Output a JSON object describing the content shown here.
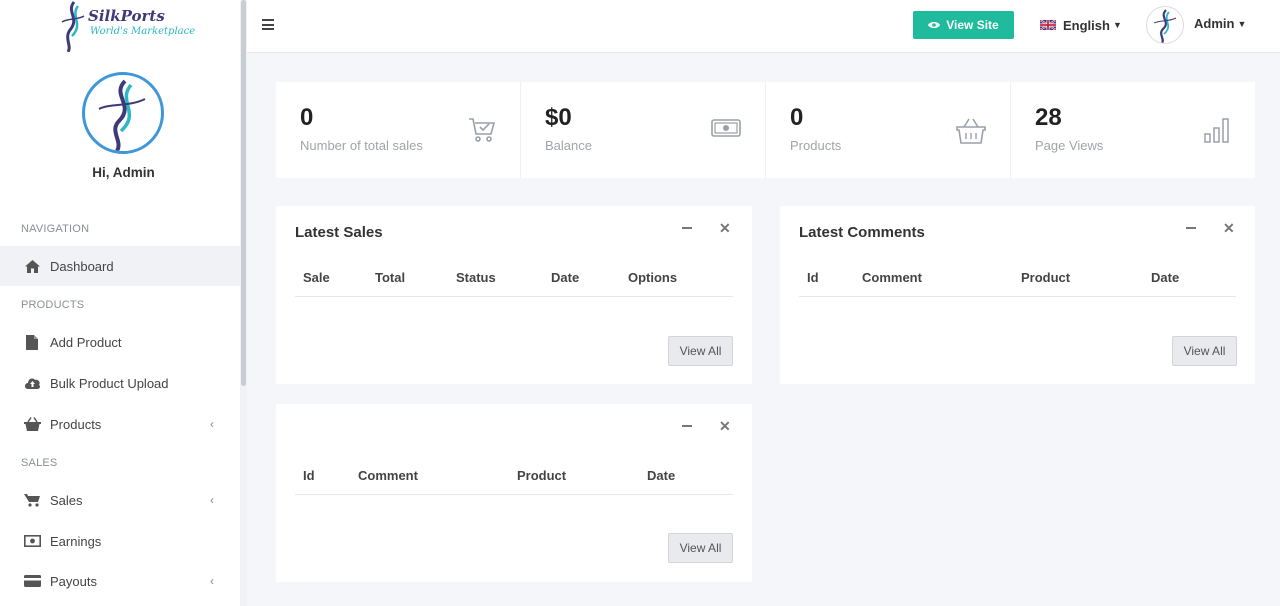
{
  "brand": {
    "name": "SilkPorts",
    "tagline": "World's Marketplace"
  },
  "sidebar": {
    "greeting": "Hi, Admin",
    "sections": {
      "navigation": "NAVIGATION",
      "products": "PRODUCTS",
      "sales": "SALES"
    },
    "items": {
      "dashboard": "Dashboard",
      "add_product": "Add Product",
      "bulk_upload": "Bulk Product Upload",
      "products": "Products",
      "sales": "Sales",
      "earnings": "Earnings",
      "payouts": "Payouts"
    }
  },
  "topbar": {
    "view_site": "View Site",
    "language": "English",
    "user": "Admin"
  },
  "stats": [
    {
      "value": "0",
      "label": "Number of total sales",
      "icon": "cart-icon"
    },
    {
      "value": "$0",
      "label": "Balance",
      "icon": "money-icon"
    },
    {
      "value": "0",
      "label": "Products",
      "icon": "basket-icon"
    },
    {
      "value": "28",
      "label": "Page Views",
      "icon": "bar-chart-icon"
    }
  ],
  "latest_sales": {
    "title": "Latest Sales",
    "columns": [
      "Sale",
      "Total",
      "Status",
      "Date",
      "Options"
    ],
    "view_all": "View All"
  },
  "latest_comments": {
    "title": "Latest Comments",
    "columns": [
      "Id",
      "Comment",
      "Product",
      "Date"
    ],
    "view_all": "View All"
  },
  "third_panel": {
    "title": "",
    "columns": [
      "Id",
      "Comment",
      "Product",
      "Date"
    ],
    "view_all": "View All"
  },
  "colors": {
    "accent": "#1fbb9c",
    "avatar_ring": "#3f97d9",
    "logo_primary": "#3d3a7a",
    "logo_secondary": "#2bb8c4"
  }
}
